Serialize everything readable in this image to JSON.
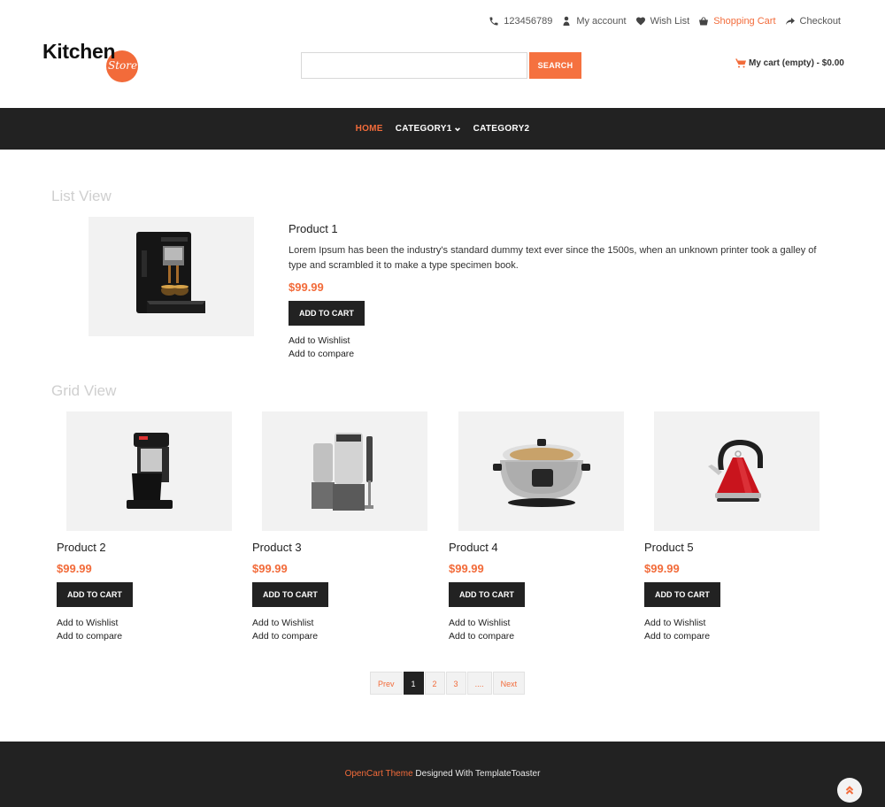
{
  "colors": {
    "accent": "#f26b3a",
    "dark": "#222222",
    "image_bg": "#f2f2f2"
  },
  "topbar": {
    "phone": {
      "icon": "phone-icon",
      "label": "123456789"
    },
    "account": {
      "icon": "user-icon",
      "label": "My account"
    },
    "wishlist": {
      "icon": "heart-icon",
      "label": "Wish List"
    },
    "cart": {
      "icon": "basket-icon",
      "label": "Shopping Cart"
    },
    "checkout": {
      "icon": "share-arrow-icon",
      "label": "Checkout"
    }
  },
  "logo": {
    "main": "Kitchen",
    "sub": "Store"
  },
  "search": {
    "placeholder": "",
    "value": "",
    "button_label": "SEARCH"
  },
  "minicart": {
    "icon": "cart-icon",
    "label": "My cart (empty) - $0.00"
  },
  "nav": {
    "items": [
      {
        "label": "HOME",
        "active": true
      },
      {
        "label": "CATEGORY1",
        "has_dropdown": true
      },
      {
        "label": "CATEGORY2"
      }
    ]
  },
  "list_view": {
    "title": "List View",
    "product": {
      "name": "Product 1",
      "image": "espresso-machine",
      "description": "Lorem Ipsum has been the industry's standard dummy text ever since the 1500s, when an unknown printer took a galley of type and scrambled it to make a type specimen book.",
      "price": "$99.99",
      "add_to_cart": "ADD TO CART",
      "wishlist": "Add to Wishlist",
      "compare": "Add to compare"
    }
  },
  "grid_view": {
    "title": "Grid View",
    "products": [
      {
        "name": "Product 2",
        "image": "coffee-maker",
        "price": "$99.99",
        "add_to_cart": "ADD TO CART",
        "wishlist": "Add to Wishlist",
        "compare": "Add to compare"
      },
      {
        "name": "Product 3",
        "image": "food-processor-set",
        "price": "$99.99",
        "add_to_cart": "ADD TO CART",
        "wishlist": "Add to Wishlist",
        "compare": "Add to compare"
      },
      {
        "name": "Product 4",
        "image": "slow-cooker",
        "price": "$99.99",
        "add_to_cart": "ADD TO CART",
        "wishlist": "Add to Wishlist",
        "compare": "Add to compare"
      },
      {
        "name": "Product 5",
        "image": "red-kettle",
        "price": "$99.99",
        "add_to_cart": "ADD TO CART",
        "wishlist": "Add to Wishlist",
        "compare": "Add to compare"
      }
    ]
  },
  "pagination": {
    "prev": "Prev",
    "pages": [
      "1",
      "2",
      "3",
      "...."
    ],
    "current": "1",
    "next": "Next"
  },
  "footer": {
    "credit_accent": "OpenCart Theme",
    "credit_rest": " Designed With TemplateToaster",
    "back_to_top_icon": "double-chevron-up-icon"
  }
}
